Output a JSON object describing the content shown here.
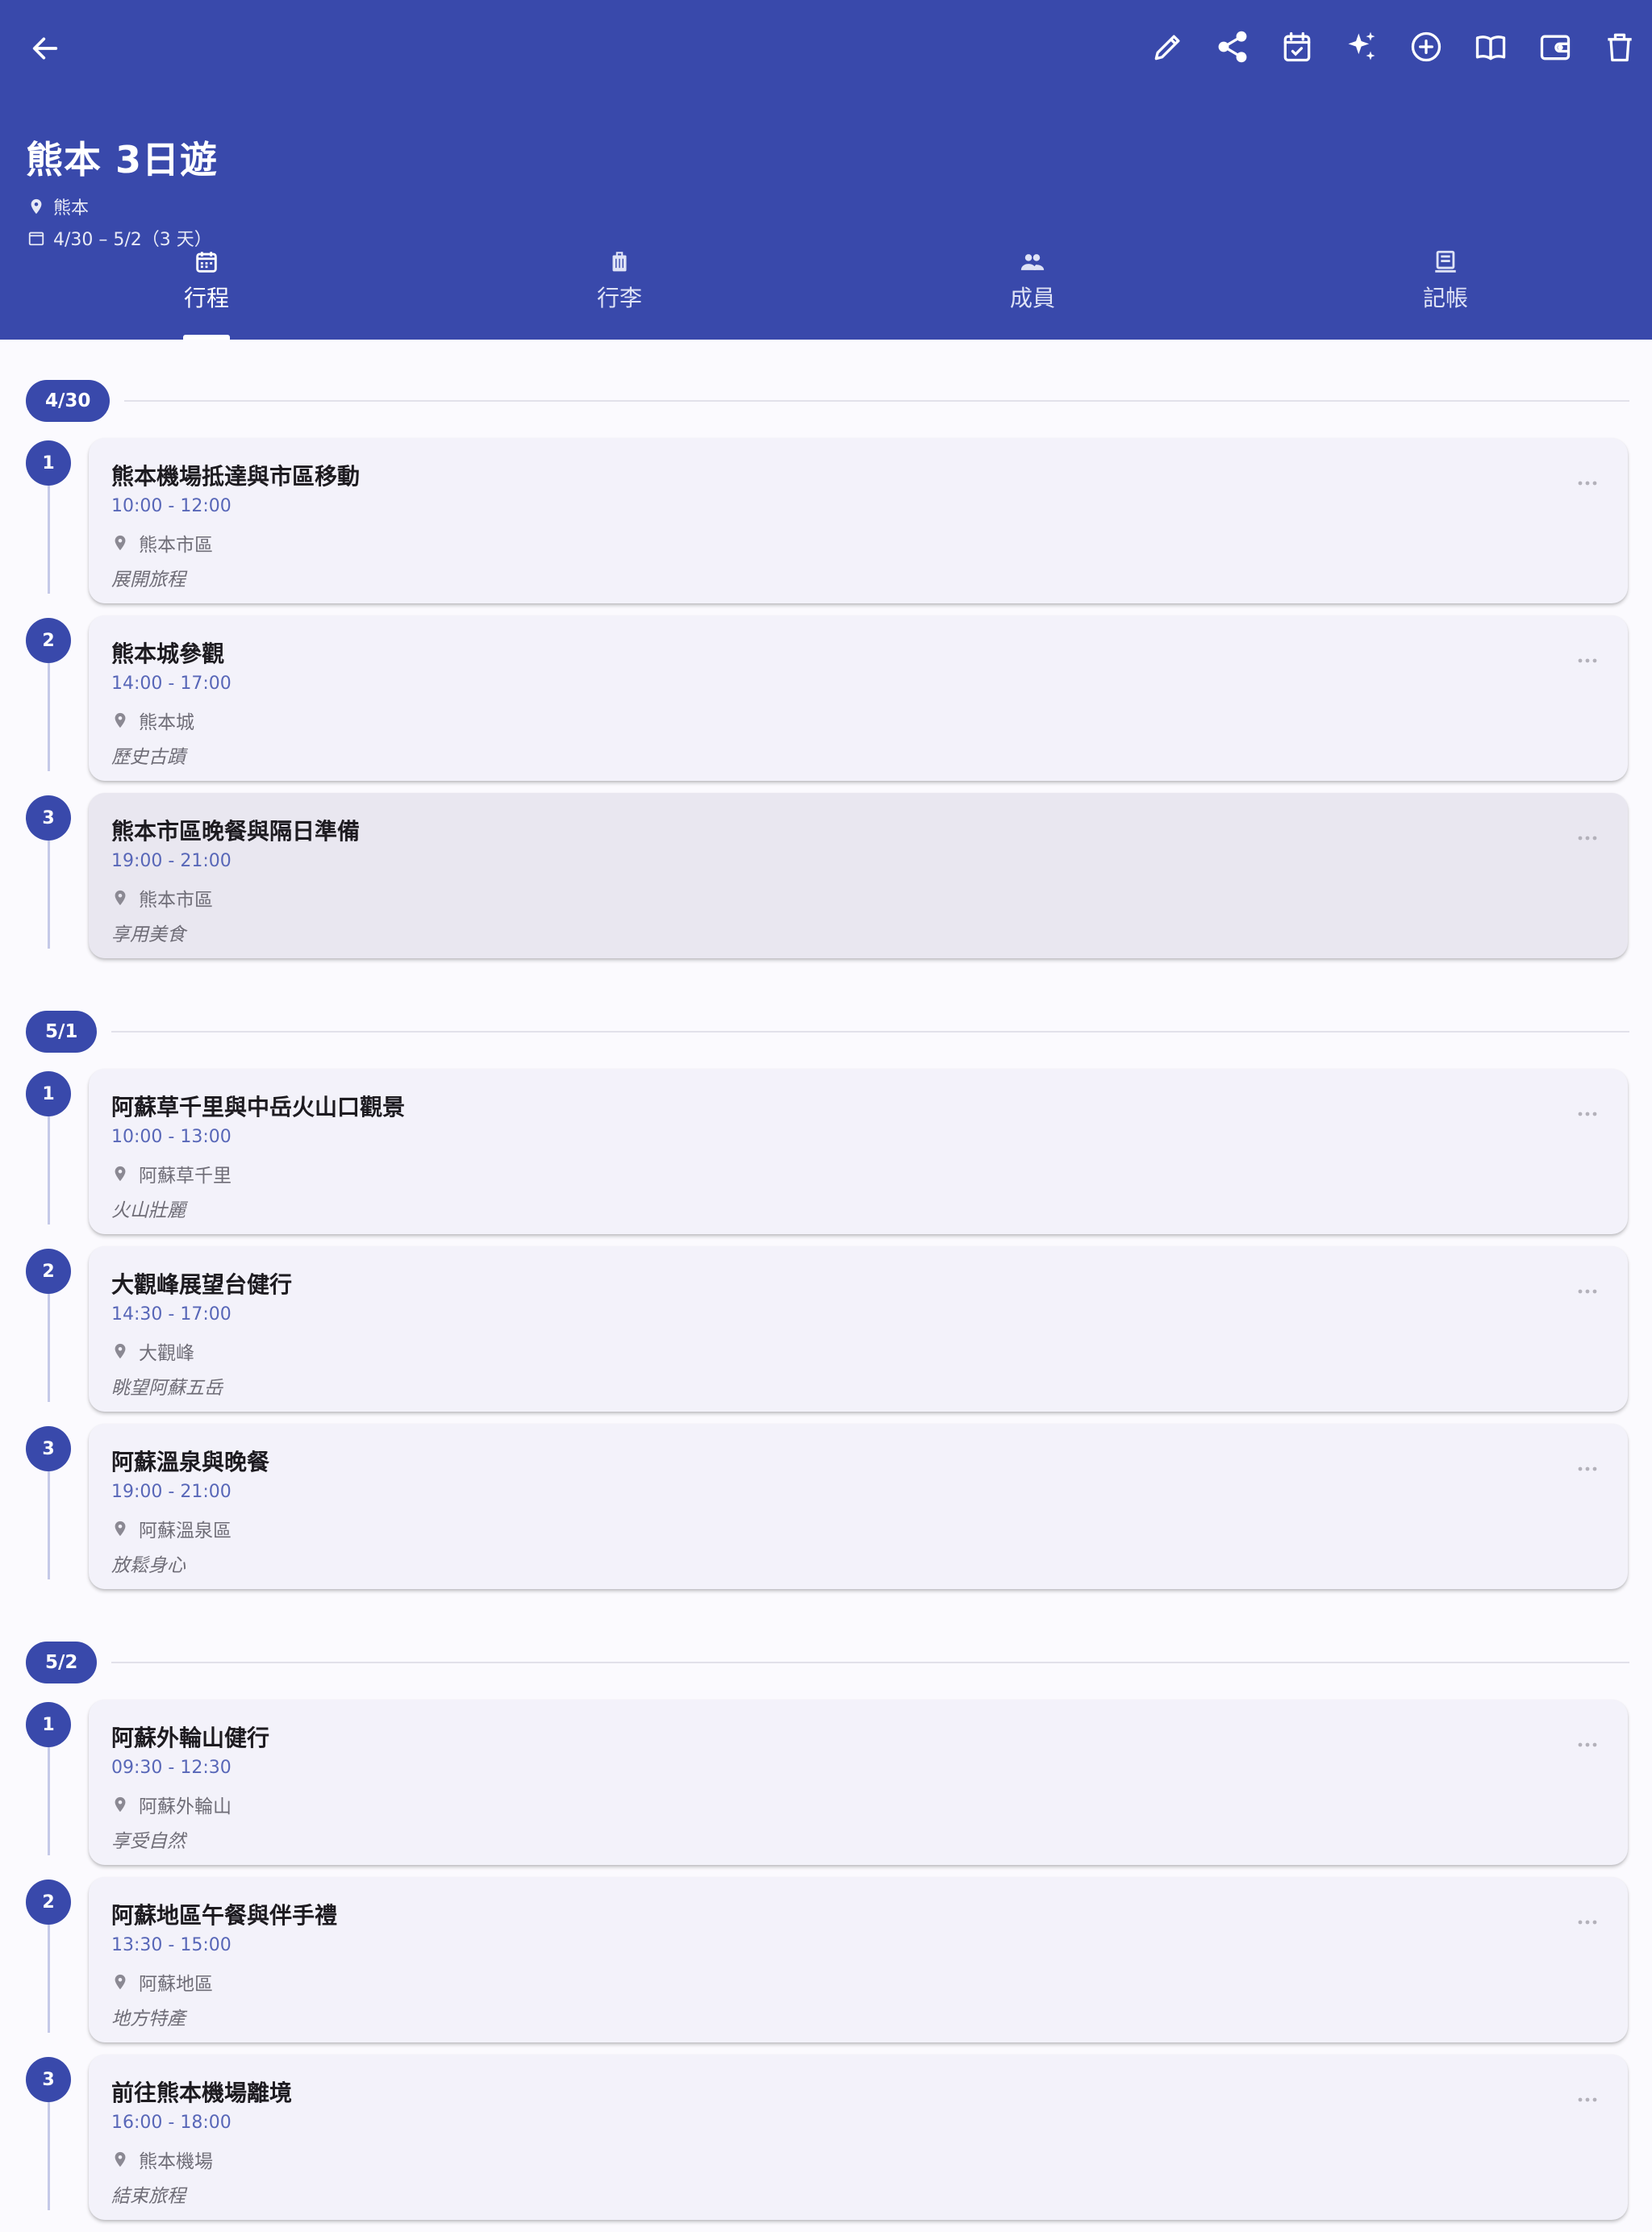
{
  "header": {
    "title": "熊本 3日遊",
    "location": "熊本",
    "date_range": "4/30 – 5/2（3 天）"
  },
  "tabs": [
    {
      "label": "行程",
      "icon": "calendar-icon",
      "active": true
    },
    {
      "label": "行李",
      "icon": "luggage-icon",
      "active": false
    },
    {
      "label": "成員",
      "icon": "people-icon",
      "active": false
    },
    {
      "label": "記帳",
      "icon": "receipt-icon",
      "active": false
    }
  ],
  "actions": [
    "edit-icon",
    "share-icon",
    "calendar-check-icon",
    "ai-sparkle-icon",
    "add-circle-icon",
    "book-icon",
    "wallet-icon",
    "delete-icon"
  ],
  "days": [
    {
      "label": "4/30",
      "items": [
        {
          "num": "1",
          "title": "熊本機場抵達與市區移動",
          "time": "10:00 - 12:00",
          "location": "熊本市區",
          "note": "展開旅程"
        },
        {
          "num": "2",
          "title": "熊本城參觀",
          "time": "14:00 - 17:00",
          "location": "熊本城",
          "note": "歷史古蹟"
        },
        {
          "num": "3",
          "title": "熊本市區晚餐與隔日準備",
          "time": "19:00 - 21:00",
          "location": "熊本市區",
          "note": "享用美食"
        }
      ]
    },
    {
      "label": "5/1",
      "items": [
        {
          "num": "1",
          "title": "阿蘇草千里與中岳火山口觀景",
          "time": "10:00 - 13:00",
          "location": "阿蘇草千里",
          "note": "火山壯麗"
        },
        {
          "num": "2",
          "title": "大觀峰展望台健行",
          "time": "14:30 - 17:00",
          "location": "大觀峰",
          "note": "眺望阿蘇五岳"
        },
        {
          "num": "3",
          "title": "阿蘇溫泉與晚餐",
          "time": "19:00 - 21:00",
          "location": "阿蘇溫泉區",
          "note": "放鬆身心"
        }
      ]
    },
    {
      "label": "5/2",
      "items": [
        {
          "num": "1",
          "title": "阿蘇外輪山健行",
          "time": "09:30 - 12:30",
          "location": "阿蘇外輪山",
          "note": "享受自然"
        },
        {
          "num": "2",
          "title": "阿蘇地區午餐與伴手禮",
          "time": "13:30 - 15:00",
          "location": "阿蘇地區",
          "note": "地方特產"
        },
        {
          "num": "3",
          "title": "前往熊本機場離境",
          "time": "16:00 - 18:00",
          "location": "熊本機場",
          "note": "結束旅程"
        }
      ]
    }
  ],
  "colors": {
    "primary": "#3949ab",
    "card": "#f3f2fa",
    "card_selected": "#e9e7f0",
    "time_text": "#5867b8"
  }
}
